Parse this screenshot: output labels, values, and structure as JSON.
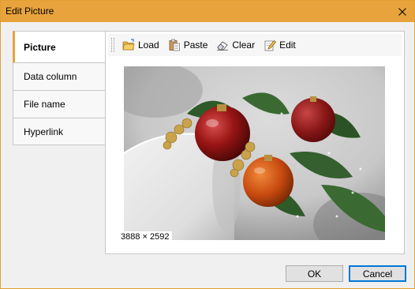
{
  "window": {
    "title": "Edit Picture"
  },
  "tabs": [
    {
      "label": "Picture",
      "active": true
    },
    {
      "label": "Data column",
      "active": false
    },
    {
      "label": "File name",
      "active": false
    },
    {
      "label": "Hyperlink",
      "active": false
    }
  ],
  "toolbar": {
    "load_label": "Load",
    "paste_label": "Paste",
    "clear_label": "Clear",
    "edit_label": "Edit"
  },
  "picture": {
    "dimensions_label": "3888 × 2592"
  },
  "buttons": {
    "ok_label": "OK",
    "cancel_label": "Cancel"
  },
  "colors": {
    "titlebar": "#e8a33c",
    "accent": "#0078d7"
  }
}
